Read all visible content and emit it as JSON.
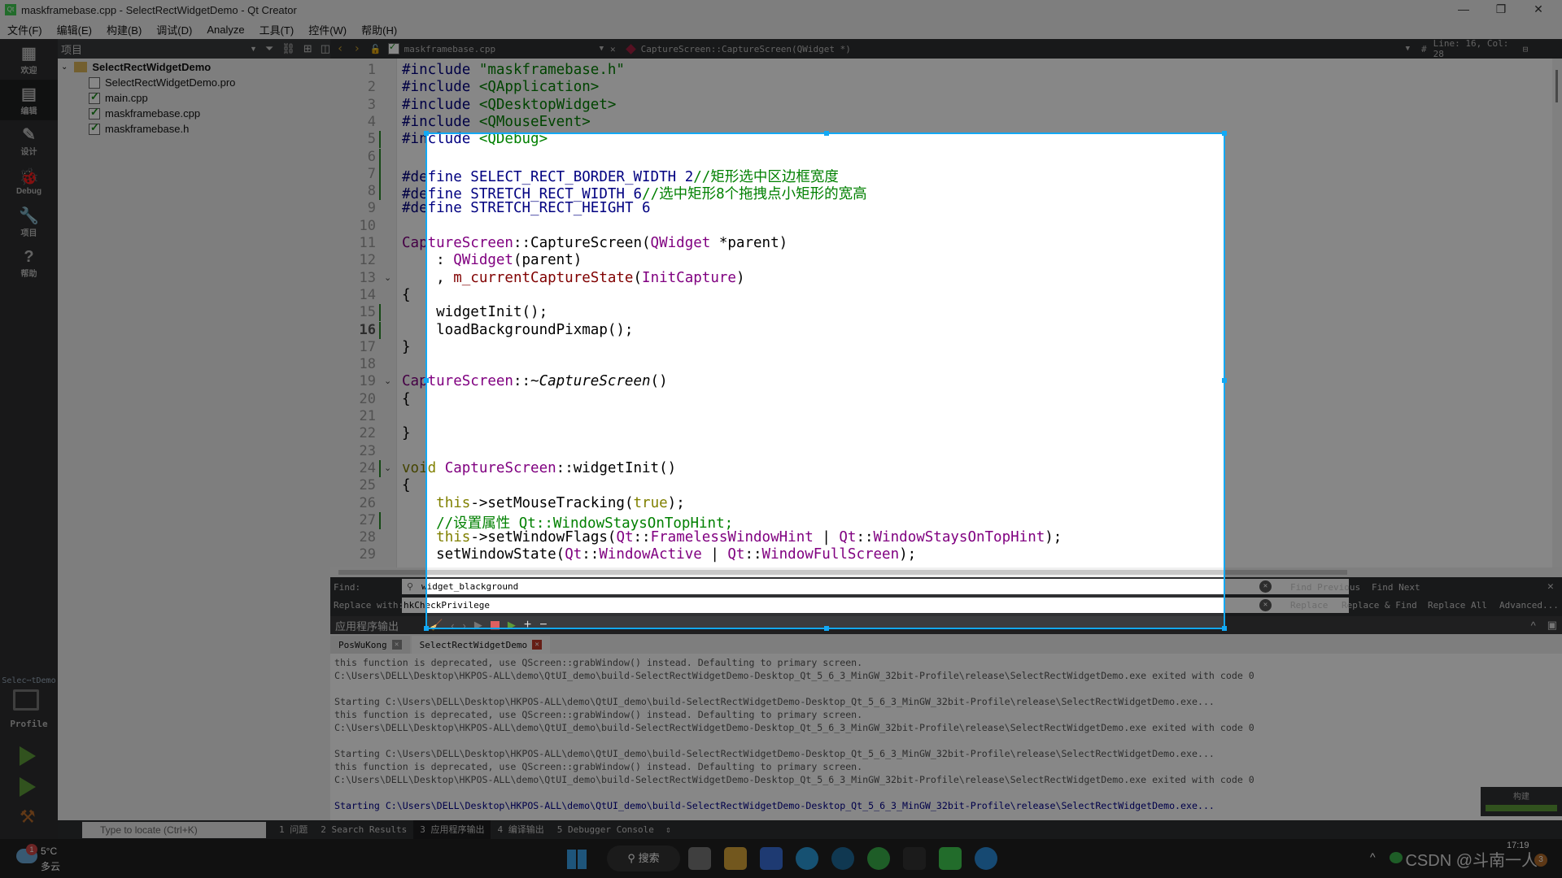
{
  "window": {
    "title": "maskframebase.cpp - SelectRectWidgetDemo - Qt Creator",
    "icon": "qt-logo"
  },
  "menu": [
    "文件(F)",
    "编辑(E)",
    "构建(B)",
    "调试(D)",
    "Analyze",
    "工具(T)",
    "控件(W)",
    "帮助(H)"
  ],
  "modes": [
    {
      "label": "欢迎",
      "icon": "grid-icon"
    },
    {
      "label": "编辑",
      "icon": "document-icon",
      "active": true
    },
    {
      "label": "设计",
      "icon": "pencil-icon"
    },
    {
      "label": "Debug",
      "icon": "bug-icon"
    },
    {
      "label": "项目",
      "icon": "wrench-icon"
    },
    {
      "label": "帮助",
      "icon": "help-icon"
    }
  ],
  "kit": {
    "project": "Selec⋯tDemo",
    "config": "Profile"
  },
  "project_panel": {
    "title": "项目",
    "root": "SelectRectWidgetDemo",
    "files": [
      "SelectRectWidgetDemo.pro",
      "main.cpp",
      "maskframebase.cpp",
      "maskframebase.h"
    ]
  },
  "editor_toolbar": {
    "file": "maskframebase.cpp",
    "symbol": "CaptureScreen::CaptureScreen(QWidget *)",
    "position": "Line: 16, Col: 28",
    "hash": "#"
  },
  "code": [
    [
      [
        "#include ",
        "pp"
      ],
      [
        "\"maskframebase.h\"",
        "str"
      ]
    ],
    [
      [
        "#include ",
        "pp"
      ],
      [
        "<QApplication>",
        "str"
      ]
    ],
    [
      [
        "#include ",
        "pp"
      ],
      [
        "<QDesktopWidget>",
        "str"
      ]
    ],
    [
      [
        "#include ",
        "pp"
      ],
      [
        "<QMouseEvent>",
        "str"
      ]
    ],
    [
      [
        "#include ",
        "pp"
      ],
      [
        "<QDebug>",
        "str"
      ]
    ],
    [],
    [
      [
        "#define ",
        "pp"
      ],
      [
        "SELECT_RECT_BORDER_WIDTH",
        "pp"
      ],
      [
        " 2",
        "pp"
      ],
      [
        "//矩形选中区边框宽度",
        "cm"
      ]
    ],
    [
      [
        "#define ",
        "pp"
      ],
      [
        "STRETCH_RECT_WIDTH",
        "pp"
      ],
      [
        " 6",
        "pp"
      ],
      [
        "//选中矩形8个拖拽点小矩形的宽高",
        "cm"
      ]
    ],
    [
      [
        "#define ",
        "pp"
      ],
      [
        "STRETCH_RECT_HEIGHT",
        "pp"
      ],
      [
        " 6",
        "pp"
      ]
    ],
    [],
    [
      [
        "CaptureScreen",
        "ty"
      ],
      [
        "::CaptureScreen(",
        ""
      ],
      [
        "QWidget",
        "ty"
      ],
      [
        " *parent)",
        ""
      ]
    ],
    [
      [
        "    : ",
        ""
      ],
      [
        "QWidget",
        "ty"
      ],
      [
        "(parent)",
        ""
      ]
    ],
    [
      [
        "    , ",
        ""
      ],
      [
        "m_currentCaptureState",
        "mem"
      ],
      [
        "(",
        ""
      ],
      [
        "InitCapture",
        "ty"
      ],
      [
        ")",
        ""
      ]
    ],
    [
      [
        "{",
        ""
      ]
    ],
    [
      [
        "    widgetInit();",
        ""
      ]
    ],
    [
      [
        "    loadBackgroundPixmap();",
        ""
      ]
    ],
    [
      [
        "}",
        ""
      ]
    ],
    [],
    [
      [
        "CaptureScreen",
        "ty"
      ],
      [
        "::~",
        ""
      ],
      [
        "CaptureScreen",
        "it"
      ],
      [
        "()",
        ""
      ]
    ],
    [
      [
        "{",
        ""
      ]
    ],
    [],
    [
      [
        "}",
        ""
      ]
    ],
    [],
    [
      [
        "void ",
        "kw"
      ],
      [
        "CaptureScreen",
        "ty"
      ],
      [
        "::widgetInit()",
        ""
      ]
    ],
    [
      [
        "{",
        ""
      ]
    ],
    [
      [
        "    ",
        ""
      ],
      [
        "this",
        "kw"
      ],
      [
        "->setMouseTracking(",
        ""
      ],
      [
        "true",
        "kw"
      ],
      [
        ");",
        ""
      ]
    ],
    [
      [
        "    //设置属性 Qt::WindowStaysOnTopHint;",
        "cm"
      ]
    ],
    [
      [
        "    ",
        ""
      ],
      [
        "this",
        "kw"
      ],
      [
        "->setWindowFlags(",
        ""
      ],
      [
        "Qt",
        "ty"
      ],
      [
        "::",
        ""
      ],
      [
        "FramelessWindowHint",
        "ty"
      ],
      [
        " | ",
        ""
      ],
      [
        "Qt",
        "ty"
      ],
      [
        "::",
        ""
      ],
      [
        "WindowStaysOnTopHint",
        "ty"
      ],
      [
        ");",
        ""
      ]
    ],
    [
      [
        "    setWindowState(",
        ""
      ],
      [
        "Qt",
        "ty"
      ],
      [
        "::",
        ""
      ],
      [
        "WindowActive",
        "ty"
      ],
      [
        " | ",
        ""
      ],
      [
        "Qt",
        "ty"
      ],
      [
        "::",
        ""
      ],
      [
        "WindowFullScreen",
        "ty"
      ],
      [
        ");",
        ""
      ]
    ]
  ],
  "current_line": 16,
  "changed_lines": [
    5,
    6,
    7,
    8,
    15,
    16,
    24,
    27
  ],
  "fold_lines": [
    13,
    19,
    24
  ],
  "find": {
    "find_label": "Find:",
    "find_value": "widget_blackground",
    "replace_label": "Replace with:",
    "replace_value": "hkCheckPrivilege",
    "find_previous": "Find Previous",
    "find_next": "Find Next",
    "replace": "Replace",
    "replace_find": "Replace & Find",
    "replace_all": "Replace All",
    "advanced": "Advanced..."
  },
  "output": {
    "title": "应用程序输出",
    "tabs": [
      "PosWuKong",
      "SelectRectWidgetDemo"
    ],
    "lines": [
      {
        "t": "this function is deprecated, use QScreen::grabWindow() instead. Defaulting to primary screen."
      },
      {
        "t": "C:\\Users\\DELL\\Desktop\\HKPOS-ALL\\demo\\QtUI_demo\\build-SelectRectWidgetDemo-Desktop_Qt_5_6_3_MinGW_32bit-Profile\\release\\SelectRectWidgetDemo.exe exited with code 0"
      },
      {
        "t": ""
      },
      {
        "t": "Starting C:\\Users\\DELL\\Desktop\\HKPOS-ALL\\demo\\QtUI_demo\\build-SelectRectWidgetDemo-Desktop_Qt_5_6_3_MinGW_32bit-Profile\\release\\SelectRectWidgetDemo.exe..."
      },
      {
        "t": "this function is deprecated, use QScreen::grabWindow() instead. Defaulting to primary screen."
      },
      {
        "t": "C:\\Users\\DELL\\Desktop\\HKPOS-ALL\\demo\\QtUI_demo\\build-SelectRectWidgetDemo-Desktop_Qt_5_6_3_MinGW_32bit-Profile\\release\\SelectRectWidgetDemo.exe exited with code 0"
      },
      {
        "t": ""
      },
      {
        "t": "Starting C:\\Users\\DELL\\Desktop\\HKPOS-ALL\\demo\\QtUI_demo\\build-SelectRectWidgetDemo-Desktop_Qt_5_6_3_MinGW_32bit-Profile\\release\\SelectRectWidgetDemo.exe..."
      },
      {
        "t": "this function is deprecated, use QScreen::grabWindow() instead. Defaulting to primary screen."
      },
      {
        "t": "C:\\Users\\DELL\\Desktop\\HKPOS-ALL\\demo\\QtUI_demo\\build-SelectRectWidgetDemo-Desktop_Qt_5_6_3_MinGW_32bit-Profile\\release\\SelectRectWidgetDemo.exe exited with code 0"
      },
      {
        "t": ""
      },
      {
        "t": "Starting C:\\Users\\DELL\\Desktop\\HKPOS-ALL\\demo\\QtUI_demo\\build-SelectRectWidgetDemo-Desktop_Qt_5_6_3_MinGW_32bit-Profile\\release\\SelectRectWidgetDemo.exe...",
        "blue": true
      }
    ]
  },
  "build": {
    "label": "构建",
    "progress": 100,
    "color": "#5e9c3a"
  },
  "statusbar": {
    "locate_placeholder": "Type to locate (Ctrl+K)",
    "panes": [
      "1 问题",
      "2 Search Results",
      "3 应用程序输出",
      "4 编译输出",
      "5 Debugger Console"
    ],
    "active": 2
  },
  "taskbar": {
    "weather_temp": "5°C",
    "weather_desc": "多云",
    "weather_badge": "1",
    "search": "搜索",
    "time": "17:19",
    "notify_badge": "3",
    "watermark": "CSDN @斗南一人"
  },
  "selection_color": "#12a9f5"
}
